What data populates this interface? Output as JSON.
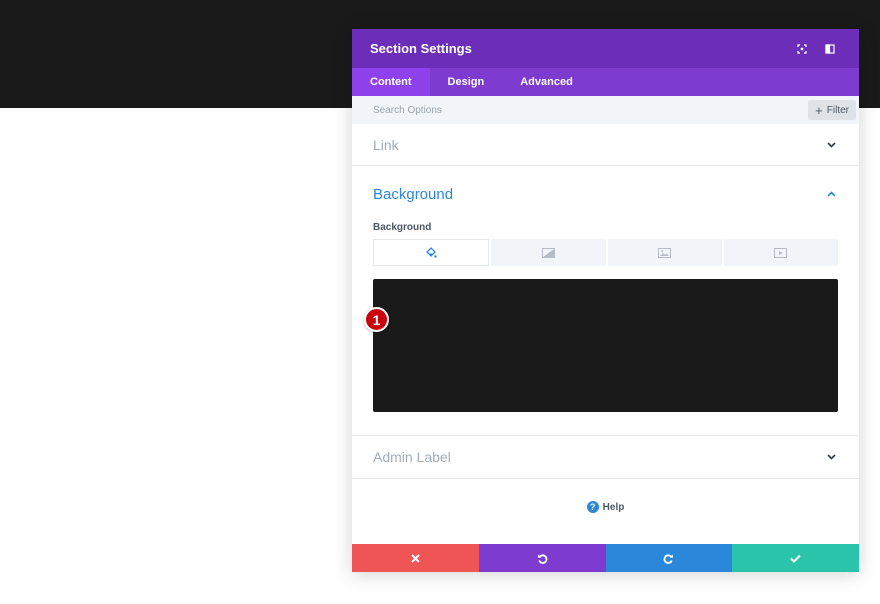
{
  "modal": {
    "title": "Section Settings",
    "header_icons": [
      "focus-icon",
      "sidebar-toggle-icon"
    ],
    "tabs": [
      {
        "label": "Content",
        "active": true
      },
      {
        "label": "Design",
        "active": false
      },
      {
        "label": "Advanced",
        "active": false
      }
    ],
    "search": {
      "placeholder": "Search Options",
      "filter_label": "Filter"
    },
    "link": {
      "title": "Link",
      "expanded": false
    },
    "background": {
      "title": "Background",
      "expanded": true,
      "field_label": "Background",
      "type_tabs": [
        "color-fill-icon",
        "gradient-icon",
        "image-icon",
        "video-icon"
      ],
      "active_type": "color-fill-icon",
      "color_value": "#1a1a1b",
      "step_badge": "1"
    },
    "admin_label": {
      "title": "Admin Label",
      "expanded": false
    },
    "help": {
      "label": "Help"
    },
    "footer": {
      "cancel_color": "#ef5555",
      "undo_color": "#7d3bcf",
      "redo_color": "#2b87da",
      "save_color": "#29c4a9"
    }
  },
  "colors": {
    "header": "#6c2eb9",
    "tabs_bar": "#7d3bcf",
    "active_tab": "#8f42ec",
    "accent_blue": "#2b87da",
    "page_dark": "#1a1a1b"
  }
}
